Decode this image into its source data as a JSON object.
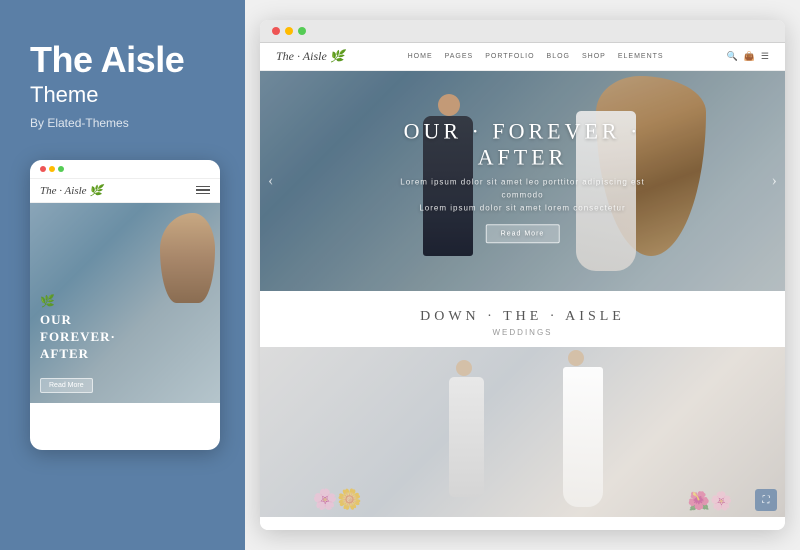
{
  "left": {
    "title": "The Aisle",
    "subtitle": "Theme",
    "byline": "By Elated-Themes",
    "mobile": {
      "logo": "The · Aisle 🌿",
      "hero_title_line1": "OUR",
      "hero_title_line2": "FOREVER·",
      "hero_title_line3": "AFTER",
      "leaf_icon": "🌿",
      "read_more": "Read More"
    }
  },
  "right": {
    "desktop": {
      "dots": [
        "#e55",
        "#fb0",
        "#5c5"
      ],
      "nav_logo": "The · Aisle 🌿",
      "nav_links": [
        "HOME",
        "PAGES",
        "PORTFOLIO",
        "BLOG",
        "SHOP",
        "ELEMENTS"
      ],
      "hero": {
        "dots_decor": "· · ·",
        "main_title": "OUR · FOREVER · AFTER",
        "subtitle": "Lorem ipsum dolor sit amet leo porttitor adipiscing est commodo\nLorem ipsum dolor sit amet lorem consectetur",
        "cta": "Read More",
        "arrow_left": "‹",
        "arrow_right": "›"
      },
      "section": {
        "main_title": "DOWN · THE · AISLE",
        "sub_label": "Weddings"
      }
    }
  }
}
